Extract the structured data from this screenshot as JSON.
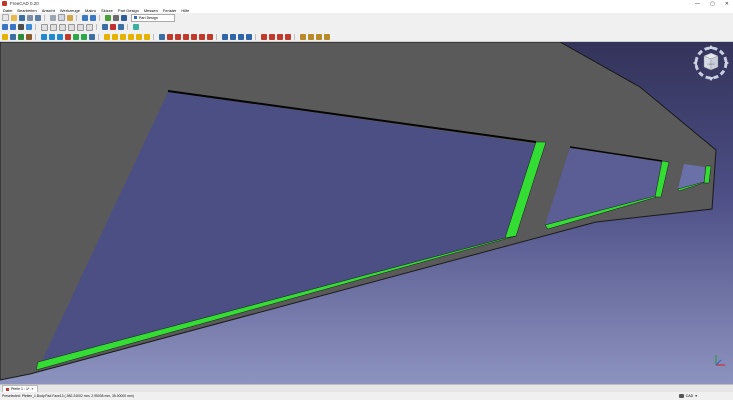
{
  "window": {
    "title": "FreeCAD 0.20",
    "minimize": "—",
    "maximize": "▢",
    "close": "✕"
  },
  "menu": [
    "Datei",
    "Bearbeiten",
    "Ansicht",
    "Werkzeuge",
    "Makro",
    "Skizze",
    "Part Design",
    "Messen",
    "Fenster",
    "Hilfe"
  ],
  "workbench": {
    "selected": "Part Design"
  },
  "tabs": [
    {
      "label": "Pfeile 1 : 1*",
      "close": "×"
    }
  ],
  "status": {
    "message": "Preselected: Pfeilen_1.Body.Pad.Face13 (-982.24002 mm, 2.95038 mm, 35.00000 mm)",
    "nav_style": "CAD",
    "nav_arrow": "▾"
  },
  "navcube": {
    "face_label": "FRONT"
  },
  "colors": {
    "background_top": "#33335a",
    "background_bottom": "#8d93bf",
    "part_face": "#5a5a5a",
    "selection_highlight": "#33dd33"
  }
}
